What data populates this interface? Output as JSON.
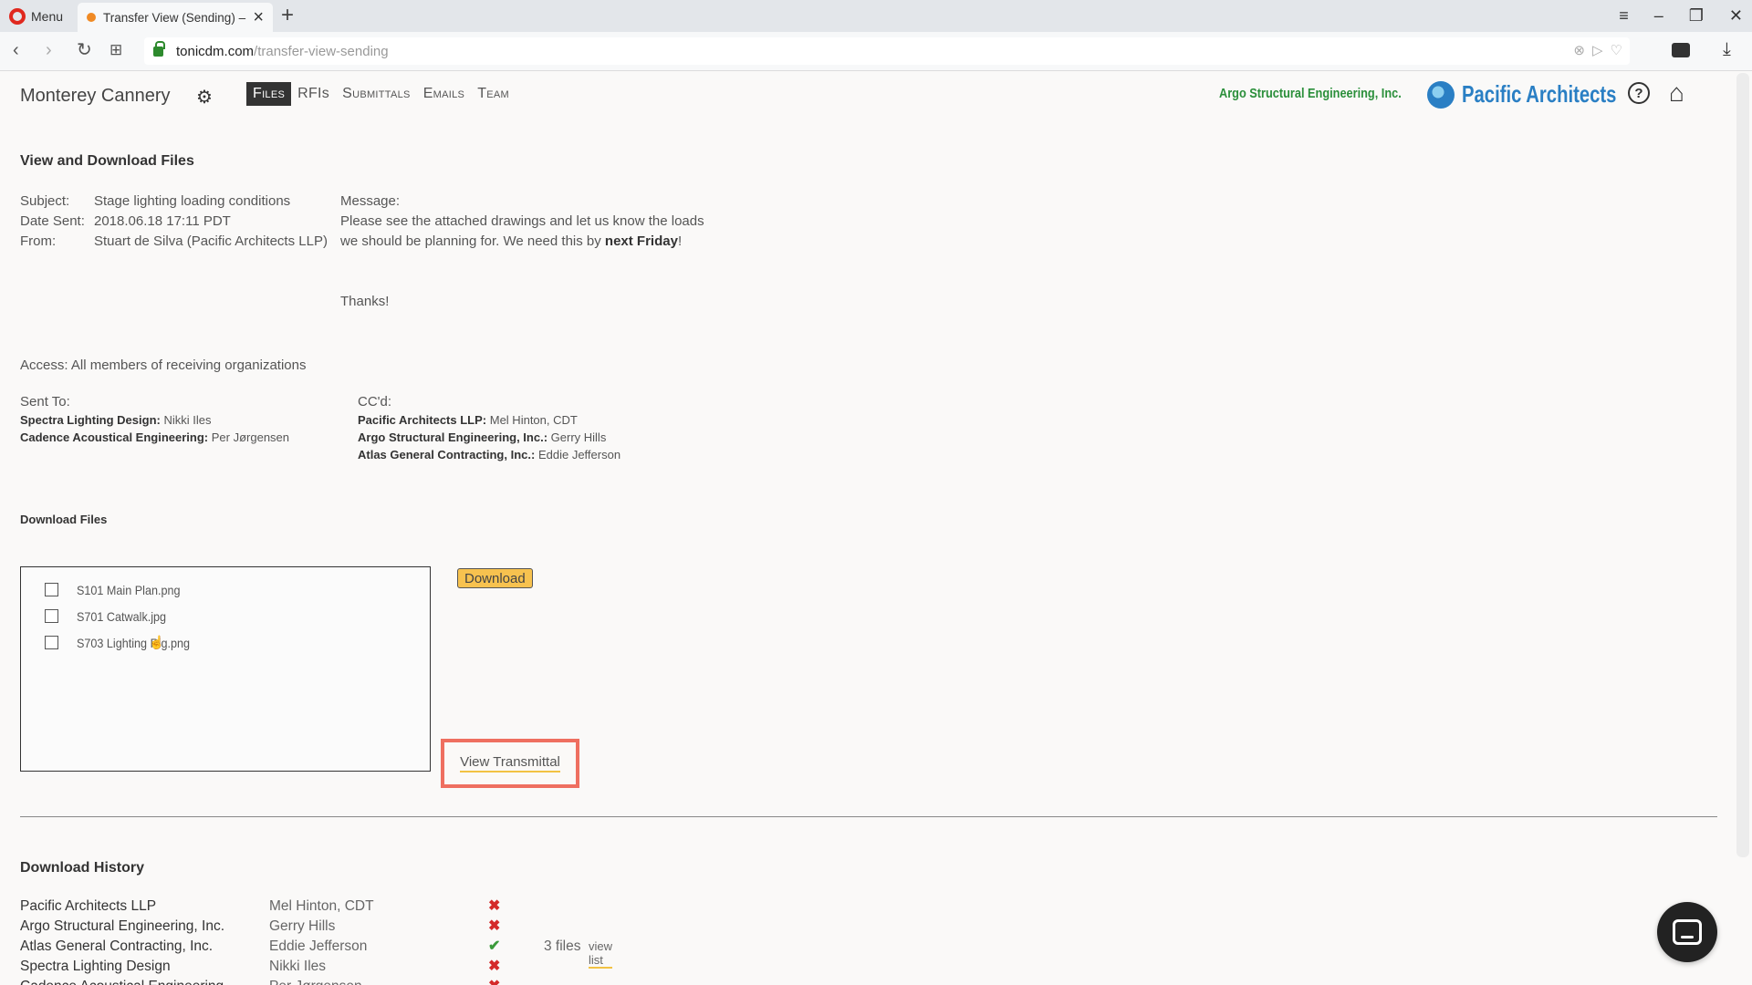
{
  "browser": {
    "menu_label": "Menu",
    "tab_title": "Transfer View (Sending) –",
    "new_tab_glyph": "+",
    "url_host": "tonicdm.com",
    "url_path": "/transfer-view-sending"
  },
  "header": {
    "project_name": "Monterey Cannery",
    "nav": [
      {
        "label": "Files",
        "active": true
      },
      {
        "label": "RFIs",
        "active": false
      },
      {
        "label": "Submittals",
        "active": false
      },
      {
        "label": "Emails",
        "active": false
      },
      {
        "label": "Team",
        "active": false
      }
    ],
    "org_left": "Argo Structural Engineering, Inc.",
    "org_right": "Pacific Architects",
    "help_glyph": "?"
  },
  "transfer": {
    "title": "View and Download Files",
    "subject_label": "Subject:",
    "subject": "Stage lighting loading conditions",
    "date_label": "Date Sent:",
    "date": "2018.06.18 17:11 PDT",
    "from_label": "From:",
    "from": "Stuart de Silva (Pacific Architects LLP)",
    "message_label": "Message:",
    "message_line1": "Please see the attached drawings and let us know the loads",
    "message_line2_pre": "we should be planning for. We need this by ",
    "message_line2_bold": "next Friday",
    "message_line2_post": "!",
    "message_thanks": "Thanks!",
    "access_label": "Access:",
    "access": "All members of receiving organizations",
    "sent_to_label": "Sent To:",
    "sent_to": [
      {
        "org": "Spectra Lighting Design:",
        "person": "Nikki Iles"
      },
      {
        "org": "Cadence Acoustical Engineering:",
        "person": "Per Jørgensen"
      }
    ],
    "cc_label": "CC'd:",
    "cc": [
      {
        "org": "Pacific Architects LLP:",
        "person": "Mel Hinton, CDT"
      },
      {
        "org": "Argo Structural Engineering, Inc.:",
        "person": "Gerry Hills"
      },
      {
        "org": "Atlas General Contracting, Inc.:",
        "person": "Eddie Jefferson"
      }
    ]
  },
  "download": {
    "title": "Download Files",
    "files": [
      "S101 Main Plan.png",
      "S701 Catwalk.jpg",
      "S703 Lighting Rig.png"
    ],
    "download_button": "Download",
    "view_transmittal": "View Transmittal"
  },
  "history": {
    "title": "Download History",
    "rows": [
      {
        "org": "Pacific Architects LLP",
        "person": "Mel Hinton, CDT",
        "downloaded": false,
        "files": "",
        "link": ""
      },
      {
        "org": "Argo Structural Engineering, Inc.",
        "person": "Gerry Hills",
        "downloaded": false,
        "files": "",
        "link": ""
      },
      {
        "org": "Atlas General Contracting, Inc.",
        "person": "Eddie Jefferson",
        "downloaded": true,
        "files": "3 files",
        "link": "view list"
      },
      {
        "org": "Spectra Lighting Design",
        "person": "Nikki Iles",
        "downloaded": false,
        "files": "",
        "link": ""
      },
      {
        "org": "Cadence Acoustical Engineering",
        "person": "Per Jørgensen",
        "downloaded": false,
        "files": "",
        "link": ""
      }
    ]
  },
  "colors": {
    "accent_yellow": "#f7c24f",
    "highlight_red": "#ef6f60",
    "argo_green": "#2a8f3a",
    "pacific_blue": "#2a7fc4"
  }
}
